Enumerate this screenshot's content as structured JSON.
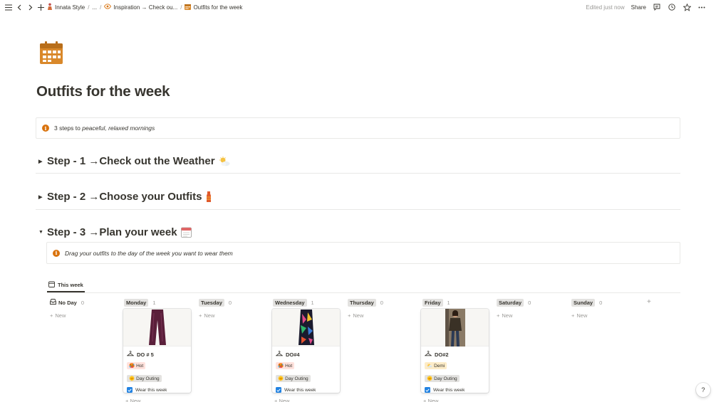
{
  "topbar": {
    "breadcrumbs": [
      "Innata Style",
      "...",
      "Inspiration → Check ou...",
      "Outfits for the week"
    ],
    "edited": "Edited just now",
    "share": "Share"
  },
  "page": {
    "title": "Outfits for the week",
    "icon": "calendar-icon"
  },
  "callout_top": {
    "prefix": "3 steps to ",
    "emphasis": "peaceful, relaxed mornings"
  },
  "toggles": [
    {
      "label": "Step - 1 →Check out the Weather",
      "emoji": "sun-behind-cloud-icon",
      "open": false
    },
    {
      "label": "Step - 2 →Choose your Outfits",
      "emoji": "outfit-icon",
      "open": false
    },
    {
      "label": "Step - 3 →Plan your week",
      "emoji": "calendar-page-icon",
      "open": true
    }
  ],
  "callout_step3": "Drag your outfits to the day of the week you want to wear them",
  "board": {
    "view_tab": "This week",
    "new_label": "New",
    "columns": [
      {
        "name": "No Day",
        "count": "0"
      },
      {
        "name": "Monday",
        "count": "1"
      },
      {
        "name": "Tuesday",
        "count": "0"
      },
      {
        "name": "Wednesday",
        "count": "1"
      },
      {
        "name": "Thursday",
        "count": "0"
      },
      {
        "name": "Friday",
        "count": "1"
      },
      {
        "name": "Saturday",
        "count": "0"
      },
      {
        "name": "Sunday",
        "count": "0"
      }
    ],
    "cards": [
      {
        "title": "DO # 5",
        "weather": "Hot",
        "activity": "Day Outing",
        "check": "Wear this week"
      },
      {
        "title": "DO#4",
        "weather": "Hot",
        "activity": "Day Outing",
        "check": "Wear this week"
      },
      {
        "title": "DO#2",
        "weather": "Demi",
        "activity": "Day Outing",
        "check": "Wear this week"
      }
    ]
  },
  "help": "?",
  "colors": {
    "accent": "#2383e2",
    "calendar": "#d9882a",
    "info": "#d9730d"
  }
}
